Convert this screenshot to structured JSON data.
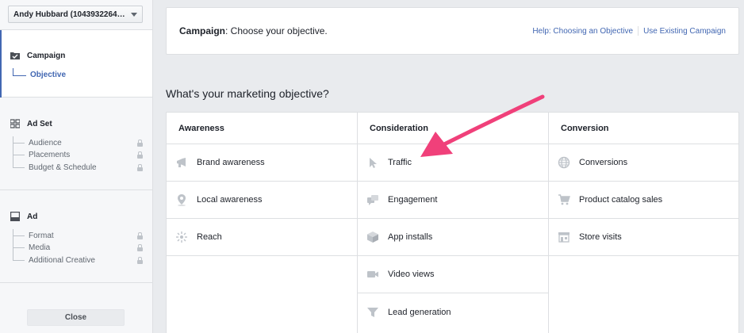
{
  "sidebar": {
    "account": "Andy Hubbard (1043932264384...",
    "campaign": {
      "heading": "Campaign",
      "active_item": "Objective"
    },
    "adset": {
      "heading": "Ad Set",
      "items": [
        "Audience",
        "Placements",
        "Budget & Schedule"
      ]
    },
    "ad": {
      "heading": "Ad",
      "items": [
        "Format",
        "Media",
        "Additional Creative"
      ]
    },
    "close_label": "Close"
  },
  "header": {
    "title_bold": "Campaign",
    "title_rest": ": Choose your objective.",
    "help_link": "Help: Choosing an Objective",
    "existing_link": "Use Existing Campaign"
  },
  "question": "What's your marketing objective?",
  "columns": {
    "awareness": {
      "heading": "Awareness",
      "items": [
        "Brand awareness",
        "Local awareness",
        "Reach"
      ]
    },
    "consideration": {
      "heading": "Consideration",
      "items": [
        "Traffic",
        "Engagement",
        "App installs",
        "Video views",
        "Lead generation"
      ]
    },
    "conversion": {
      "heading": "Conversion",
      "items": [
        "Conversions",
        "Product catalog sales",
        "Store visits"
      ]
    }
  },
  "colors": {
    "accent": "#4267b2",
    "annotation_arrow": "#f0407a",
    "icon_gray": "#90949c"
  }
}
